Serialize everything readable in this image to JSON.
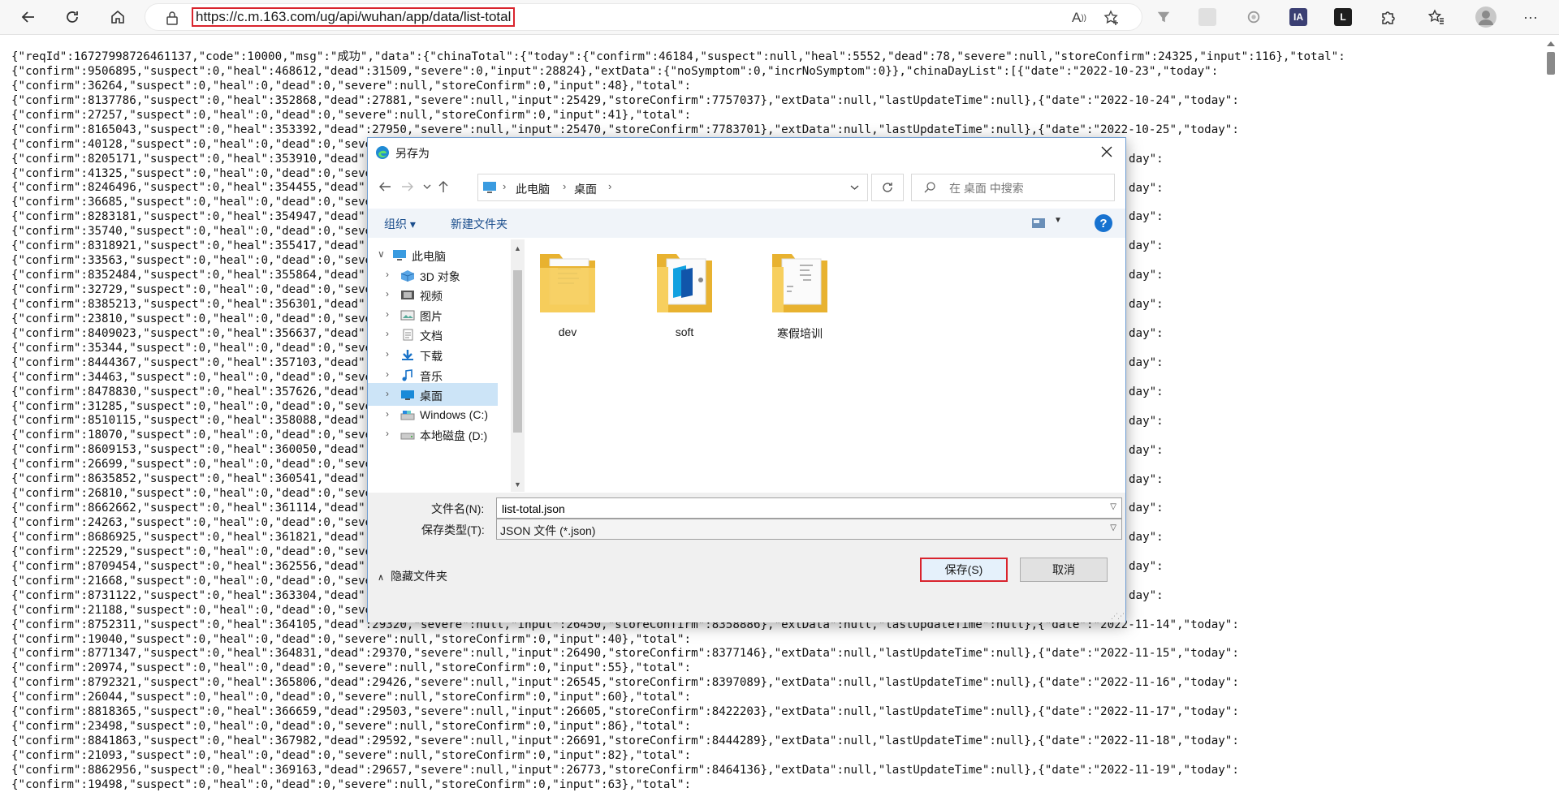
{
  "browser": {
    "url": "https://c.m.163.com/ug/api/wuhan/app/data/list-total",
    "read_aloud_label": "A",
    "extension_ia_label": "IA",
    "extension_l_label": "L"
  },
  "json_lines": [
    "{\"reqId\":16727998726461137,\"code\":10000,\"msg\":\"成功\",\"data\":{\"chinaTotal\":{\"today\":{\"confirm\":46184,\"suspect\":null,\"heal\":5552,\"dead\":78,\"severe\":null,\"storeConfirm\":24325,\"input\":116},\"total\":",
    "{\"confirm\":9506895,\"suspect\":0,\"heal\":468612,\"dead\":31509,\"severe\":0,\"input\":28824},\"extData\":{\"noSymptom\":0,\"incrNoSymptom\":0}},\"chinaDayList\":[{\"date\":\"2022-10-23\",\"today\":",
    "{\"confirm\":36264,\"suspect\":0,\"heal\":0,\"dead\":0,\"severe\":null,\"storeConfirm\":0,\"input\":48},\"total\":",
    "{\"confirm\":8137786,\"suspect\":0,\"heal\":352868,\"dead\":27881,\"severe\":null,\"input\":25429,\"storeConfirm\":7757037},\"extData\":null,\"lastUpdateTime\":null},{\"date\":\"2022-10-24\",\"today\":",
    "{\"confirm\":27257,\"suspect\":0,\"heal\":0,\"dead\":0,\"severe\":null,\"storeConfirm\":0,\"input\":41},\"total\":",
    "{\"confirm\":8165043,\"suspect\":0,\"heal\":353392,\"dead\":27950,\"severe\":null,\"input\":25470,\"storeConfirm\":7783701},\"extData\":null,\"lastUpdateTime\":null},{\"date\":\"2022-10-25\",\"today\":",
    "{\"confirm\":40128,\"suspect\":0,\"heal\":0,\"dead\":0,\"severe\"",
    "{\"confirm\":8205171,\"suspect\":0,\"heal\":353910,\"dead\":2800",
    "{\"confirm\":41325,\"suspect\":0,\"heal\":0,\"dead\":0,\"severe\"",
    "{\"confirm\":8246496,\"suspect\":0,\"heal\":354455,\"dead\":2806",
    "{\"confirm\":36685,\"suspect\":0,\"heal\":0,\"dead\":0,\"severe\"",
    "{\"confirm\":8283181,\"suspect\":0,\"heal\":354947,\"dead\":2815",
    "{\"confirm\":35740,\"suspect\":0,\"heal\":0,\"dead\":0,\"severe\"",
    "{\"confirm\":8318921,\"suspect\":0,\"heal\":355417,\"dead\":2822",
    "{\"confirm\":33563,\"suspect\":0,\"heal\":0,\"dead\":0,\"severe\"",
    "{\"confirm\":8352484,\"suspect\":0,\"heal\":355864,\"dead\":2830",
    "{\"confirm\":32729,\"suspect\":0,\"heal\":0,\"dead\":0,\"severe\"",
    "{\"confirm\":8385213,\"suspect\":0,\"heal\":356301,\"dead\":2838",
    "{\"confirm\":23810,\"suspect\":0,\"heal\":0,\"dead\":0,\"severe\"",
    "{\"confirm\":8409023,\"suspect\":0,\"heal\":356637,\"dead\":2846",
    "{\"confirm\":35344,\"suspect\":0,\"heal\":0,\"dead\":0,\"severe\"",
    "{\"confirm\":8444367,\"suspect\":0,\"heal\":357103,\"dead\":2851",
    "{\"confirm\":34463,\"suspect\":0,\"heal\":0,\"dead\":0,\"severe\"",
    "{\"confirm\":8478830,\"suspect\":0,\"heal\":357626,\"dead\":2857",
    "{\"confirm\":31285,\"suspect\":0,\"heal\":0,\"dead\":0,\"severe\"",
    "{\"confirm\":8510115,\"suspect\":0,\"heal\":358088,\"dead\":2861",
    "{\"confirm\":18070,\"suspect\":0,\"heal\":0,\"dead\":0,\"severe\"",
    "{\"confirm\":8609153,\"suspect\":0,\"heal\":360050,\"dead\":2893",
    "{\"confirm\":26699,\"suspect\":0,\"heal\":0,\"dead\":0,\"severe\"",
    "{\"confirm\":8635852,\"suspect\":0,\"heal\":360541,\"dead\":2895",
    "{\"confirm\":26810,\"suspect\":0,\"heal\":0,\"dead\":0,\"severe\"",
    "{\"confirm\":8662662,\"suspect\":0,\"heal\":361114,\"dead\":2903",
    "{\"confirm\":24263,\"suspect\":0,\"heal\":0,\"dead\":0,\"severe\"",
    "{\"confirm\":8686925,\"suspect\":0,\"heal\":361821,\"dead\":2911",
    "{\"confirm\":22529,\"suspect\":0,\"heal\":0,\"dead\":0,\"severe\"",
    "{\"confirm\":8709454,\"suspect\":0,\"heal\":362556,\"dead\":2918",
    "{\"confirm\":21668,\"suspect\":0,\"heal\":0,\"dead\":0,\"severe\"",
    "{\"confirm\":8731122,\"suspect\":0,\"heal\":363304,\"dead\":2925",
    "{\"confirm\":21188,\"suspect\":0,\"heal\":0,\"dead\":0,\"severe\"",
    "{\"confirm\":8752311,\"suspect\":0,\"heal\":364105,\"dead\":29320,\"severe\":null,\"input\":26450,\"storeConfirm\":8358886},\"extData\":null,\"lastUpdateTime\":null},{\"date\":\"2022-11-14\",\"today\":",
    "{\"confirm\":19040,\"suspect\":0,\"heal\":0,\"dead\":0,\"severe\":null,\"storeConfirm\":0,\"input\":40},\"total\":",
    "{\"confirm\":8771347,\"suspect\":0,\"heal\":364831,\"dead\":29370,\"severe\":null,\"input\":26490,\"storeConfirm\":8377146},\"extData\":null,\"lastUpdateTime\":null},{\"date\":\"2022-11-15\",\"today\":",
    "{\"confirm\":20974,\"suspect\":0,\"heal\":0,\"dead\":0,\"severe\":null,\"storeConfirm\":0,\"input\":55},\"total\":",
    "{\"confirm\":8792321,\"suspect\":0,\"heal\":365806,\"dead\":29426,\"severe\":null,\"input\":26545,\"storeConfirm\":8397089},\"extData\":null,\"lastUpdateTime\":null},{\"date\":\"2022-11-16\",\"today\":",
    "{\"confirm\":26044,\"suspect\":0,\"heal\":0,\"dead\":0,\"severe\":null,\"storeConfirm\":0,\"input\":60},\"total\":",
    "{\"confirm\":8818365,\"suspect\":0,\"heal\":366659,\"dead\":29503,\"severe\":null,\"input\":26605,\"storeConfirm\":8422203},\"extData\":null,\"lastUpdateTime\":null},{\"date\":\"2022-11-17\",\"today\":",
    "{\"confirm\":23498,\"suspect\":0,\"heal\":0,\"dead\":0,\"severe\":null,\"storeConfirm\":0,\"input\":86},\"total\":",
    "{\"confirm\":8841863,\"suspect\":0,\"heal\":367982,\"dead\":29592,\"severe\":null,\"input\":26691,\"storeConfirm\":8444289},\"extData\":null,\"lastUpdateTime\":null},{\"date\":\"2022-11-18\",\"today\":",
    "{\"confirm\":21093,\"suspect\":0,\"heal\":0,\"dead\":0,\"severe\":null,\"storeConfirm\":0,\"input\":82},\"total\":",
    "{\"confirm\":8862956,\"suspect\":0,\"heal\":369163,\"dead\":29657,\"severe\":null,\"input\":26773,\"storeConfirm\":8464136},\"extData\":null,\"lastUpdateTime\":null},{\"date\":\"2022-11-19\",\"today\":",
    "{\"confirm\":19498,\"suspect\":0,\"heal\":0,\"dead\":0,\"severe\":null,\"storeConfirm\":0,\"input\":63},\"total\":"
  ],
  "json_lines_right": [
    {
      "text": "day\":"
    },
    {
      "text": "day\":"
    },
    {
      "text": "day\":"
    },
    {
      "text": "day\":"
    },
    {
      "text": "day\":"
    },
    {
      "text": "day\":"
    },
    {
      "text": "day\":"
    },
    {
      "text": "day\":"
    },
    {
      "text": "day\":"
    },
    {
      "text": "day\":"
    },
    {
      "text": "day\":"
    },
    {
      "text": "day\":"
    },
    {
      "text": "day\":"
    },
    {
      "text": "day\":"
    },
    {
      "text": "day\":"
    },
    {
      "text": "day\":"
    },
    {
      "text": "day\":"
    }
  ],
  "dialog": {
    "title": "另存为",
    "breadcrumb": [
      "此电脑",
      "桌面"
    ],
    "search_placeholder": "在 桌面 中搜索",
    "organize_label": "组织 ▾",
    "new_folder_label": "新建文件夹",
    "help_label": "?",
    "tree": [
      {
        "label": "此电脑",
        "icon": "pc-icon",
        "expanded": true
      },
      {
        "label": "3D 对象",
        "icon": "3d-objects-icon"
      },
      {
        "label": "视频",
        "icon": "video-icon"
      },
      {
        "label": "图片",
        "icon": "pictures-icon"
      },
      {
        "label": "文档",
        "icon": "documents-icon"
      },
      {
        "label": "下载",
        "icon": "download-icon"
      },
      {
        "label": "音乐",
        "icon": "music-icon"
      },
      {
        "label": "桌面",
        "icon": "desktop-icon",
        "selected": true
      },
      {
        "label": "Windows (C:)",
        "icon": "drive-c-icon"
      },
      {
        "label": "本地磁盘 (D:)",
        "icon": "drive-d-icon"
      }
    ],
    "files": [
      {
        "name": "dev"
      },
      {
        "name": "soft"
      },
      {
        "name": "寒假培训"
      }
    ],
    "filename_label": "文件名(N):",
    "filename_value": "list-total.json",
    "filetype_label": "保存类型(T):",
    "filetype_value": "JSON 文件 (*.json)",
    "hide_folders_label": "隐藏文件夹",
    "save_label": "保存(S)",
    "cancel_label": "取消"
  },
  "colors": {
    "highlight_red": "#d9242d",
    "selection_blue": "#cce4f7",
    "folder_yellow": "#f4c84a",
    "accent_blue": "#0078d7"
  }
}
